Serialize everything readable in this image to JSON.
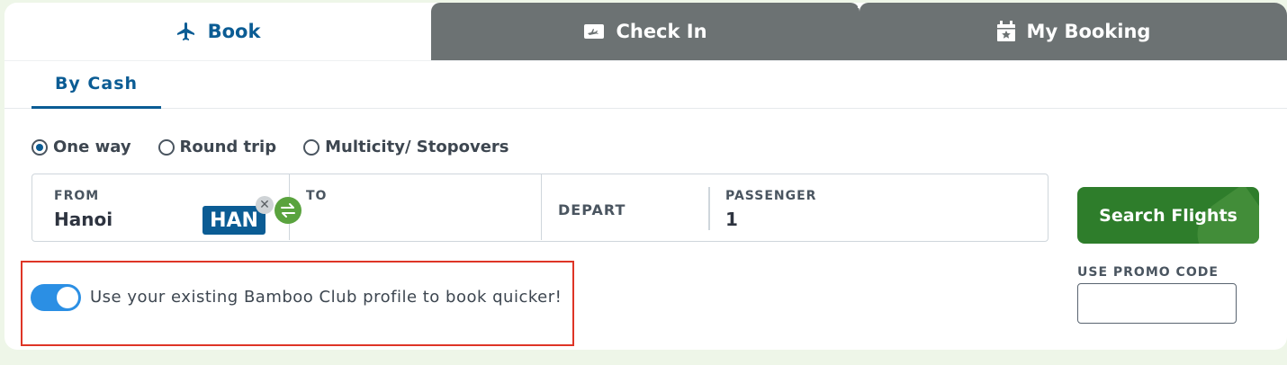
{
  "tabs": {
    "book": "Book",
    "checkin": "Check In",
    "my_booking": "My Booking"
  },
  "subtab": {
    "by_cash": "By Cash"
  },
  "trip_type": {
    "options": [
      "One way",
      "Round trip",
      "Multicity/ Stopovers"
    ],
    "selected": "One way"
  },
  "search": {
    "from_label": "FROM",
    "from_value": "Hanoi",
    "from_code": "HAN",
    "to_label": "TO",
    "to_value": "",
    "depart_label": "DEPART",
    "passenger_label": "PASSENGER",
    "passenger_value": "1",
    "button": "Search Flights"
  },
  "bamboo": {
    "toggle_on": true,
    "text": "Use your existing Bamboo Club profile to book quicker!"
  },
  "promo": {
    "label": "USE PROMO CODE",
    "value": ""
  },
  "colors": {
    "brand_blue": "#0b5c94",
    "tab_gray": "#6c7273",
    "search_green": "#2e7d2b",
    "toggle_blue": "#2b8fe4",
    "highlight_red": "#de3526"
  },
  "icons": {
    "book": "airplane-icon",
    "checkin": "boarding-pass-icon",
    "my_booking": "calendar-star-icon",
    "swap": "swap-arrows-icon",
    "clear": "close-icon"
  }
}
